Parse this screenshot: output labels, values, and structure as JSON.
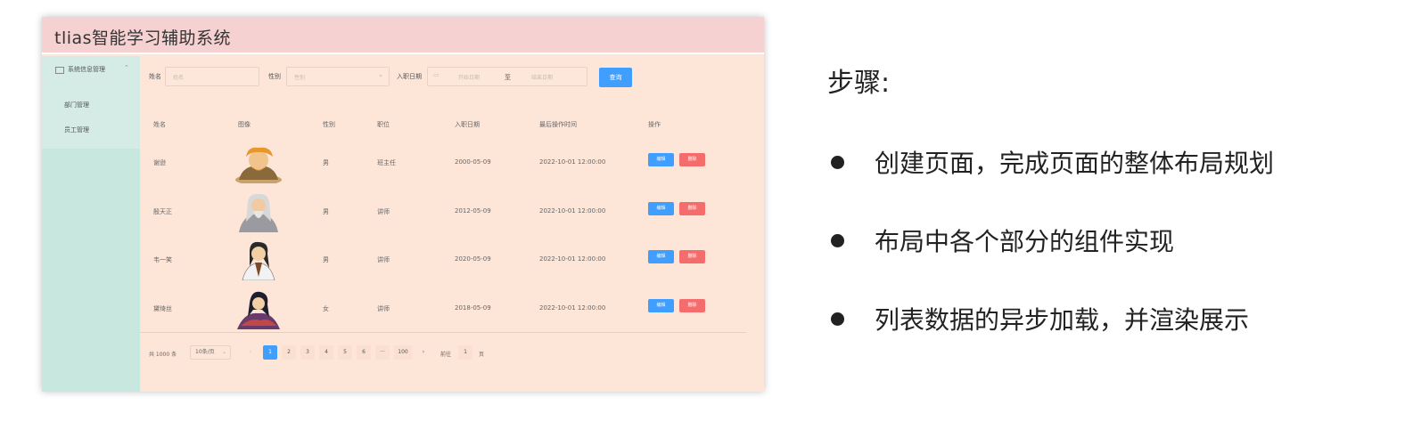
{
  "app": {
    "title": "tlias智能学习辅助系统"
  },
  "sidebar": {
    "group_label": "系统信息管理",
    "items": [
      {
        "label": "部门管理"
      },
      {
        "label": "员工管理"
      }
    ]
  },
  "search": {
    "name_label": "姓名",
    "name_placeholder": "姓名",
    "gender_label": "性别",
    "gender_placeholder": "性别",
    "date_label": "入职日期",
    "start_placeholder": "开始日期",
    "range_sep": "至",
    "end_placeholder": "结束日期",
    "query_button": "查询"
  },
  "table": {
    "headers": [
      "姓名",
      "图像",
      "性别",
      "职位",
      "入职日期",
      "最后操作时间",
      "操作"
    ],
    "rows": [
      {
        "name": "谢逊",
        "gender": "男",
        "position": "班主任",
        "entry_date": "2000-05-09",
        "updated": "2022-10-01 12:00:00"
      },
      {
        "name": "殷天正",
        "gender": "男",
        "position": "讲师",
        "entry_date": "2012-05-09",
        "updated": "2022-10-01 12:00:00"
      },
      {
        "name": "韦一笑",
        "gender": "男",
        "position": "讲师",
        "entry_date": "2020-05-09",
        "updated": "2022-10-01 12:00:00"
      },
      {
        "name": "黛绮丝",
        "gender": "女",
        "position": "讲师",
        "entry_date": "2018-05-09",
        "updated": "2022-10-01 12:00:00"
      }
    ],
    "edit_label": "编辑",
    "delete_label": "删除"
  },
  "pagination": {
    "total_text": "共 1000 条",
    "page_size": "10条/页",
    "pages": [
      "1",
      "2",
      "3",
      "4",
      "5",
      "6",
      "···",
      "100"
    ],
    "current_page": "1",
    "goto_prefix": "前往",
    "goto_value": "1",
    "goto_suffix": "页"
  },
  "notes": {
    "title": "步骤:",
    "steps": [
      "创建页面，完成页面的整体布局规划",
      "布局中各个部分的组件实现",
      "列表数据的异步加载，并渲染展示"
    ]
  },
  "colors": {
    "header_bg": "#f6d1d1",
    "sidebar_bg": "#c7e7df",
    "main_bg": "#fde5d8",
    "primary": "#409eff",
    "danger": "#f56c6c"
  },
  "icons": {
    "menu_group": "message-icon",
    "menu_chevron": "chevron-up-icon",
    "calendar": "calendar-icon",
    "select_arrow": "chevron-down-icon",
    "prev": "chevron-left-icon",
    "next": "chevron-right-icon"
  }
}
